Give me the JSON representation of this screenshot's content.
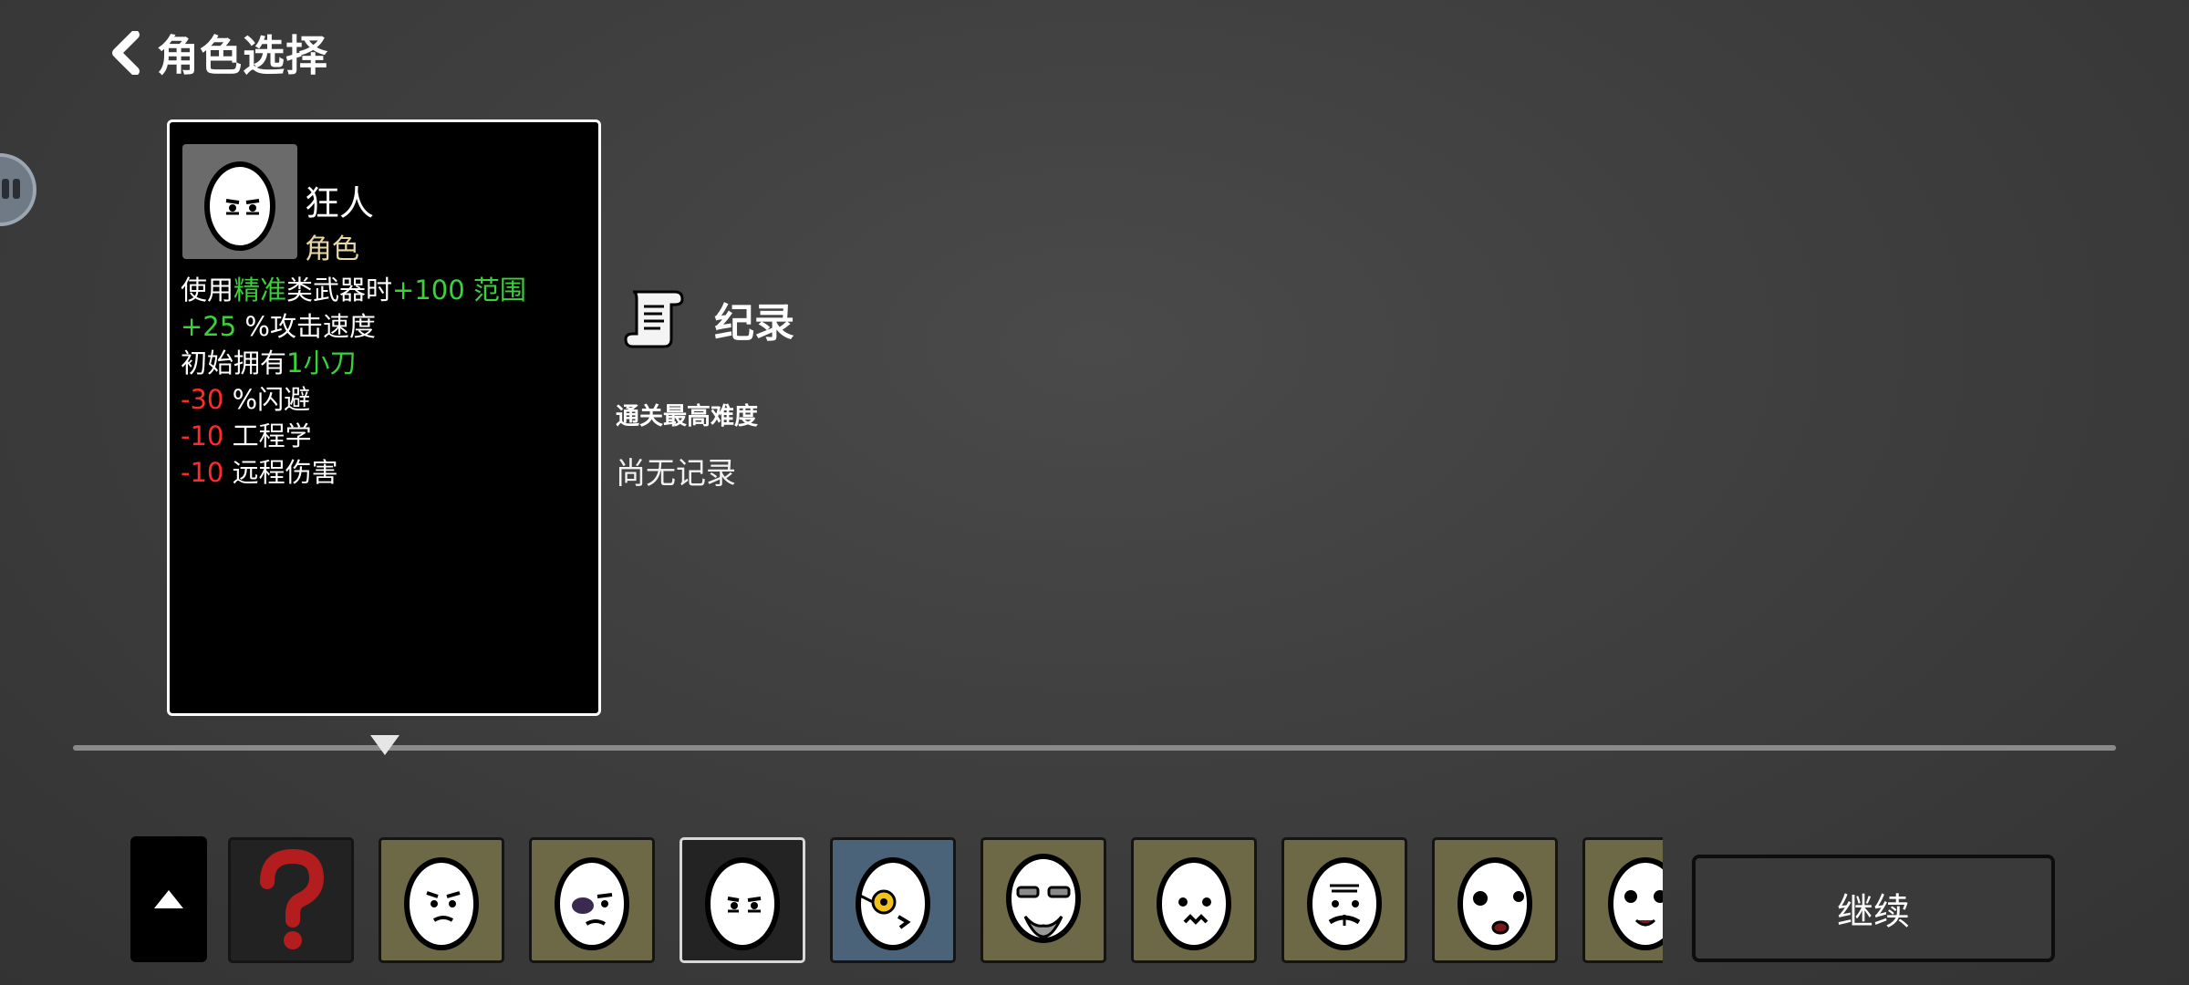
{
  "header": {
    "title": "角色选择",
    "back_icon": "chevron-left-icon"
  },
  "character": {
    "name": "狂人",
    "type": "角色",
    "stats": [
      {
        "parts": [
          {
            "text": "使用",
            "color": "white"
          },
          {
            "text": "精准",
            "color": "green"
          },
          {
            "text": "类武器时",
            "color": "white"
          },
          {
            "text": "+100 范围",
            "color": "green"
          }
        ]
      },
      {
        "parts": [
          {
            "text": "+25",
            "color": "green"
          },
          {
            "text": " %攻击速度",
            "color": "white"
          }
        ]
      },
      {
        "parts": [
          {
            "text": "初始拥有",
            "color": "white"
          },
          {
            "text": "1小刀",
            "color": "green"
          }
        ]
      },
      {
        "parts": [
          {
            "text": "-30",
            "color": "red"
          },
          {
            "text": " %闪避",
            "color": "white"
          }
        ]
      },
      {
        "parts": [
          {
            "text": "-10",
            "color": "red"
          },
          {
            "text": " 工程学",
            "color": "white"
          }
        ]
      },
      {
        "parts": [
          {
            "text": "-10",
            "color": "red"
          },
          {
            "text": " 远程伤害",
            "color": "white"
          }
        ]
      }
    ]
  },
  "records": {
    "title": "纪录",
    "subtitle": "通关最高难度",
    "value": "尚无记录",
    "icon": "scroll-icon"
  },
  "roster": {
    "slots": [
      {
        "id": "random",
        "kind": "random",
        "icon": "question-mark-icon"
      },
      {
        "id": "grumpy",
        "kind": "normal",
        "icon": "grumpy-egg-icon"
      },
      {
        "id": "bruised",
        "kind": "normal",
        "icon": "bruised-egg-icon"
      },
      {
        "id": "madman",
        "kind": "selected",
        "icon": "madman-egg-icon"
      },
      {
        "id": "monocle",
        "kind": "blue",
        "icon": "monocle-egg-icon"
      },
      {
        "id": "bearded",
        "kind": "normal",
        "icon": "bearded-egg-icon"
      },
      {
        "id": "surprised",
        "kind": "normal",
        "icon": "surprised-egg-icon"
      },
      {
        "id": "mustache",
        "kind": "normal",
        "icon": "mustache-egg-icon"
      },
      {
        "id": "wideeyed",
        "kind": "normal",
        "icon": "wide-eyed-egg-icon"
      },
      {
        "id": "partial",
        "kind": "normal",
        "icon": "partial-egg-icon"
      }
    ]
  },
  "continue_button": {
    "label": "继续"
  },
  "colors": {
    "green": "#3ad13a",
    "red": "#ff2a2a",
    "gold": "#e8d7a5",
    "slot_normal": "#6d6846",
    "slot_blue": "#4a6378"
  }
}
